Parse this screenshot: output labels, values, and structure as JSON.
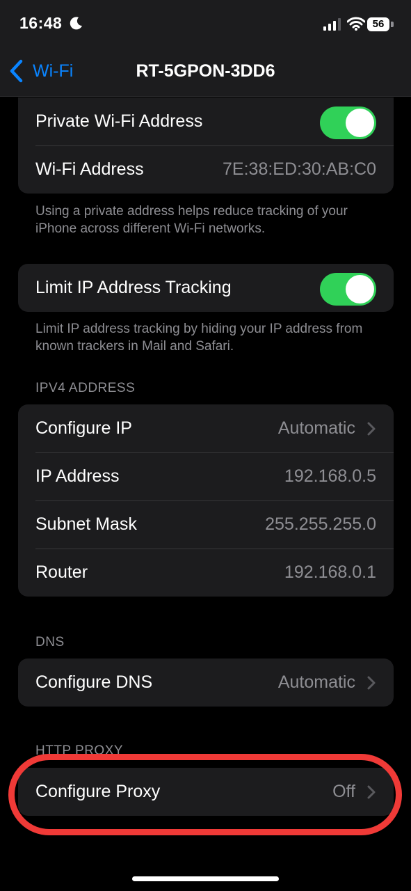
{
  "status_bar": {
    "time": "16:48",
    "battery": "56",
    "icons": [
      "moon-icon",
      "cellular-signal-icon",
      "wifi-icon",
      "battery-icon"
    ]
  },
  "nav": {
    "back_label": "Wi-Fi",
    "title": "RT-5GPON-3DD6"
  },
  "private_group": {
    "private_address_label": "Private Wi-Fi Address",
    "private_address_on": true,
    "wifi_address_label": "Wi-Fi Address",
    "wifi_address_value": "7E:38:ED:30:AB:C0",
    "footer": "Using a private address helps reduce tracking of your iPhone across different Wi-Fi networks."
  },
  "limit_group": {
    "label": "Limit IP Address Tracking",
    "on": true,
    "footer": "Limit IP address tracking by hiding your IP address from known trackers in Mail and Safari."
  },
  "ipv4": {
    "header": "IPV4 ADDRESS",
    "rows": [
      {
        "label": "Configure IP",
        "value": "Automatic"
      },
      {
        "label": "IP Address",
        "value": "192.168.0.5"
      },
      {
        "label": "Subnet Mask",
        "value": "255.255.255.0"
      },
      {
        "label": "Router",
        "value": "192.168.0.1"
      }
    ]
  },
  "dns": {
    "header": "DNS",
    "label": "Configure DNS",
    "value": "Automatic"
  },
  "proxy": {
    "header": "HTTP PROXY",
    "label": "Configure Proxy",
    "value": "Off"
  },
  "colors": {
    "accent": "#0a84ff",
    "toggle_on": "#30d158",
    "highlight": "#f03a37",
    "cell_bg": "#1c1c1e"
  }
}
